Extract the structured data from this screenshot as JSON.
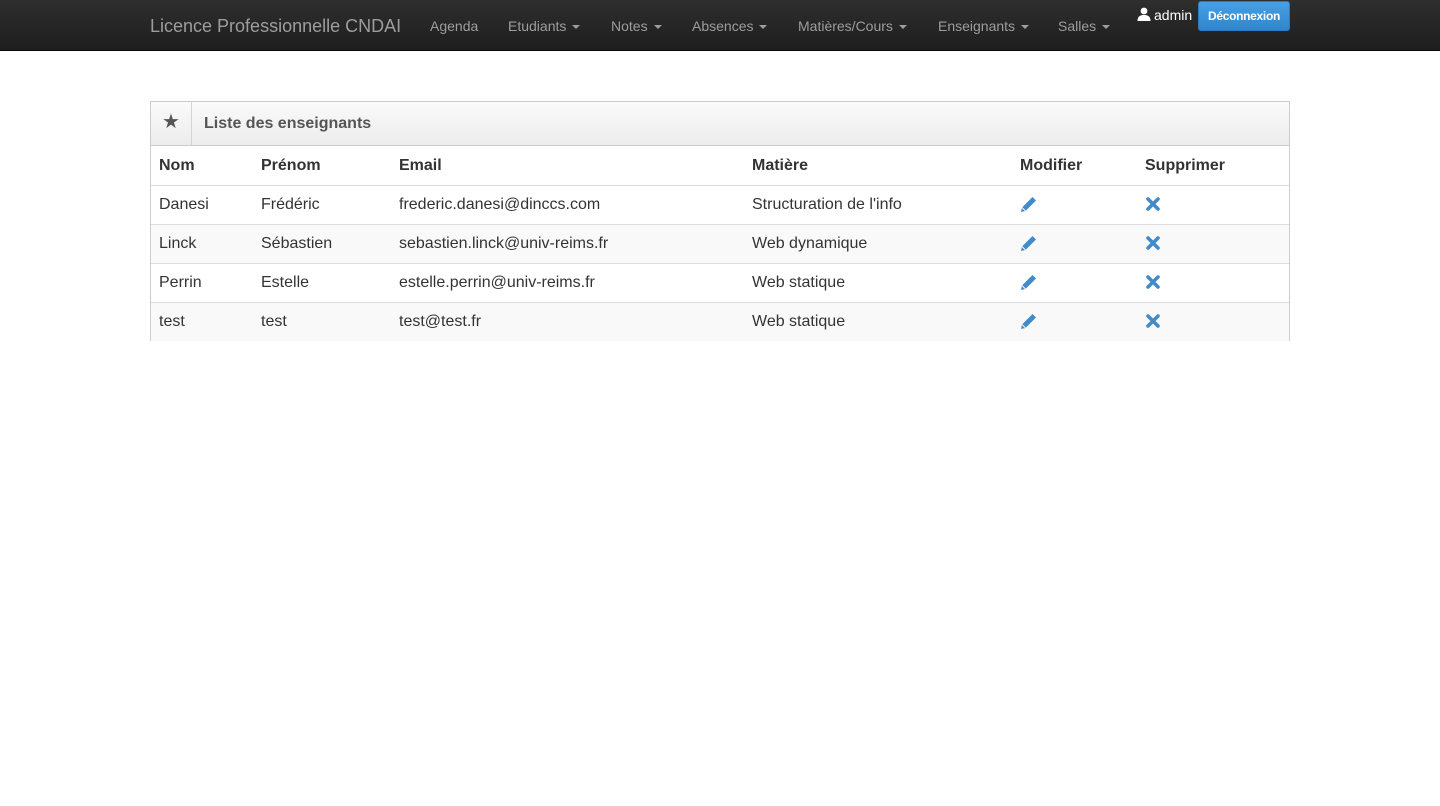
{
  "navbar": {
    "brand": "Licence Professionnelle CNDAI",
    "items": [
      {
        "label": "Agenda",
        "dropdown": false
      },
      {
        "label": "Etudiants",
        "dropdown": true
      },
      {
        "label": "Notes",
        "dropdown": true
      },
      {
        "label": "Absences",
        "dropdown": true
      },
      {
        "label": "Matières/Cours",
        "dropdown": true
      },
      {
        "label": "Enseignants",
        "dropdown": true
      },
      {
        "label": "Salles",
        "dropdown": true
      }
    ],
    "user": {
      "icon": "user-icon",
      "name": "admin"
    },
    "logout_label": "Déconnexion"
  },
  "panel": {
    "icon": "star-icon",
    "title": "Liste des enseignants"
  },
  "table": {
    "headers": {
      "nom": "Nom",
      "prenom": "Prénom",
      "email": "Email",
      "matiere": "Matière",
      "modifier": "Modifier",
      "supprimer": "Supprimer"
    },
    "rows": [
      {
        "nom": "Danesi",
        "prenom": "Frédéric",
        "email": "frederic.danesi@dinccs.com",
        "matiere": "Structuration de l'info"
      },
      {
        "nom": "Linck",
        "prenom": "Sébastien",
        "email": "sebastien.linck@univ-reims.fr",
        "matiere": "Web dynamique"
      },
      {
        "nom": "Perrin",
        "prenom": "Estelle",
        "email": "estelle.perrin@univ-reims.fr",
        "matiere": "Web statique"
      },
      {
        "nom": "test",
        "prenom": "test",
        "email": "test@test.fr",
        "matiere": "Web statique"
      }
    ]
  },
  "colors": {
    "navbar_bg": "#222222",
    "nav_text": "#9d9d9d",
    "accent": "#428bca",
    "row_stripe": "#f9f9f9"
  }
}
